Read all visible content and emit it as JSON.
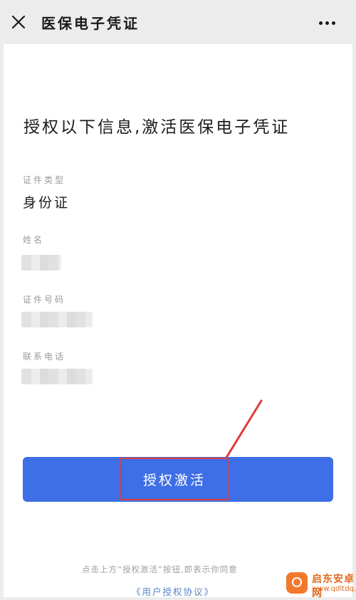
{
  "header": {
    "title": "医保电子凭证",
    "close_icon": "close-icon",
    "more_icon": "more-icon"
  },
  "main": {
    "heading": "授权以下信息,激活医保电子凭证",
    "fields": [
      {
        "label": "证件类型",
        "value": "身份证"
      },
      {
        "label": "姓名",
        "value": ""
      },
      {
        "label": "证件号码",
        "value": ""
      },
      {
        "label": "联系电话",
        "value": ""
      }
    ],
    "activate_button": "授权激活",
    "notice": "点击上方“授权激活”按钮,即表示你同意",
    "agreement_link": "《用户授权协议》"
  },
  "watermark": {
    "name": "启东安卓网",
    "url": "www.qdltdq.com"
  },
  "colors": {
    "button": "#3f6fe6",
    "highlight": "#e03a3a",
    "link": "#5a84c8",
    "background": "#ececec"
  }
}
